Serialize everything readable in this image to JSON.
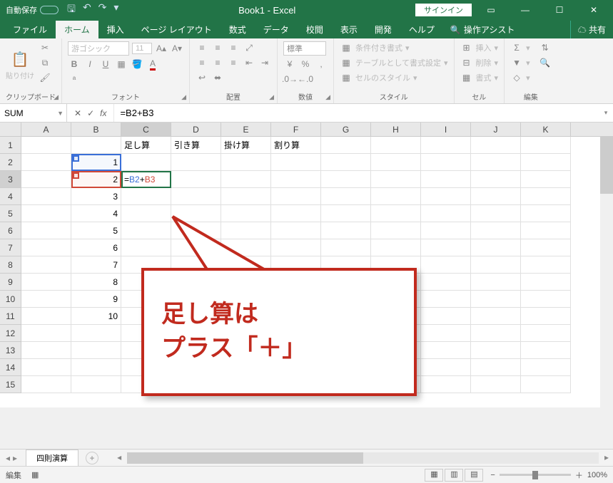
{
  "titlebar": {
    "autosave": "自動保存",
    "title": "Book1 - Excel",
    "signin": "サインイン"
  },
  "tabs": {
    "file": "ファイル",
    "home": "ホーム",
    "insert": "挿入",
    "pagelayout": "ページ レイアウト",
    "formulas": "数式",
    "data": "データ",
    "review": "校閲",
    "view": "表示",
    "developer": "開発",
    "help": "ヘルプ",
    "tellme": "操作アシスト",
    "share": "共有"
  },
  "ribbon": {
    "clipboard": {
      "label": "クリップボード",
      "paste": "貼り付け"
    },
    "font": {
      "label": "フォント",
      "name": "游ゴシック",
      "size": "11"
    },
    "align": {
      "label": "配置"
    },
    "number": {
      "label": "数値",
      "fmt": "標準"
    },
    "styles": {
      "label": "スタイル",
      "cond": "条件付き書式",
      "table": "テーブルとして書式設定",
      "cell": "セルのスタイル"
    },
    "cells": {
      "label": "セル",
      "insert": "挿入",
      "delete": "削除",
      "format": "書式"
    },
    "editing": {
      "label": "編集"
    }
  },
  "fbar": {
    "name": "SUM",
    "formula": "=B2+B3"
  },
  "columns": [
    "A",
    "B",
    "C",
    "D",
    "E",
    "F",
    "G",
    "H",
    "I",
    "J",
    "K"
  ],
  "rows": [
    "1",
    "2",
    "3",
    "4",
    "5",
    "6",
    "7",
    "8",
    "9",
    "10",
    "11",
    "12",
    "13",
    "14",
    "15"
  ],
  "cells": {
    "C1": "足し算",
    "D1": "引き算",
    "E1": "掛け算",
    "F1": "割り算",
    "B2": "1",
    "B3": "2",
    "B4": "3",
    "B5": "4",
    "B6": "5",
    "B7": "6",
    "B8": "7",
    "B9": "8",
    "B10": "9",
    "B11": "10",
    "C3_prefix": "=",
    "C3_b2": "B2",
    "C3_plus": "+",
    "C3_b3": "B3"
  },
  "callout": {
    "line1": "足し算は",
    "line2": "プラス「＋」"
  },
  "sheet": {
    "name": "四則演算"
  },
  "status": {
    "mode": "編集",
    "zoom": "100%"
  }
}
